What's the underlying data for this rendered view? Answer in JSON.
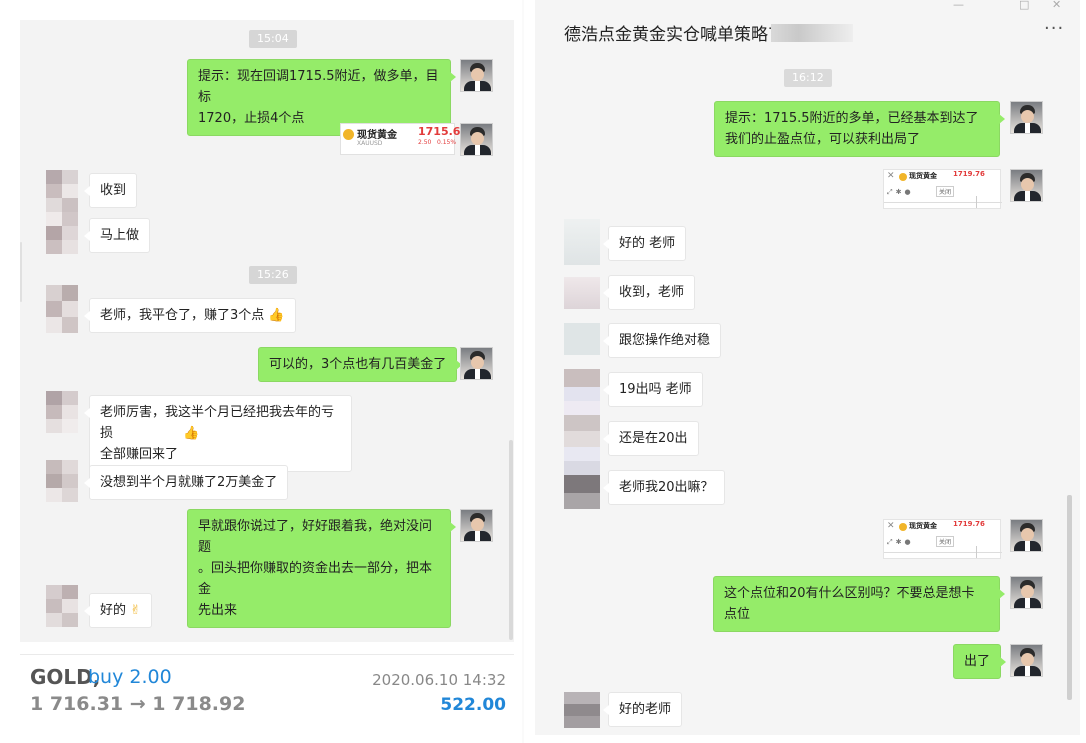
{
  "left_chat": {
    "timestamps": [
      "15:04",
      "15:26"
    ],
    "messages": [
      {
        "text": "提示：现在回调1715.5附近，做多单，目标\n1720，止损4个点"
      },
      {
        "text": "收到"
      },
      {
        "text": "马上做"
      },
      {
        "text": "老师，我平仓了，赚了3个点"
      },
      {
        "text": "可以的，3个点也有几百美金了"
      },
      {
        "text": "老师厉害，我这半个月已经把我去年的亏损\n全部赚回来了"
      },
      {
        "text": "没想到半个月就赚了2万美金了"
      },
      {
        "text": "早就跟你说过了，好好跟着我，绝对没问题\n。回头把你赚取的资金出去一部分，把本金\n先出来"
      },
      {
        "text": "好的"
      }
    ],
    "quote_card": {
      "name": "现货黄金",
      "symbol": "XAUUSD",
      "price": "1715.6",
      "change": "2.50",
      "change_pct": "0.15%"
    }
  },
  "trade": {
    "symbol": "GOLD,",
    "action": "buy 2.00",
    "prices": "1 716.31 → 1 718.92",
    "datetime": "2020.06.10 14:32",
    "profit": "522.00"
  },
  "right_chat": {
    "title": "德浩点金黄金实仓喊单策略7群",
    "menu_icon": "more-icon",
    "timestamps": [
      "16:12"
    ],
    "messages": [
      {
        "text": "提示：1715.5附近的多单，已经基本到达了\n我们的止盈点位，可以获利出局了"
      },
      {
        "text": "好的 老师"
      },
      {
        "text": "收到，老师"
      },
      {
        "text": "跟您操作绝对稳"
      },
      {
        "text": "19出吗 老师"
      },
      {
        "text": "还是在20出"
      },
      {
        "text": "老师我20出嘛？"
      },
      {
        "text": "这个点位和20有什么区别吗？不要总是想卡\n点位"
      },
      {
        "text": "出了"
      },
      {
        "text": "好的老师"
      }
    ],
    "mini_card": {
      "name": "现货黄金",
      "price": "1719.76",
      "btn": "关闭"
    }
  },
  "colors": {
    "bubble_me": "#95ec69",
    "bubble_them": "#ffffff",
    "accent": "#2187d8"
  }
}
